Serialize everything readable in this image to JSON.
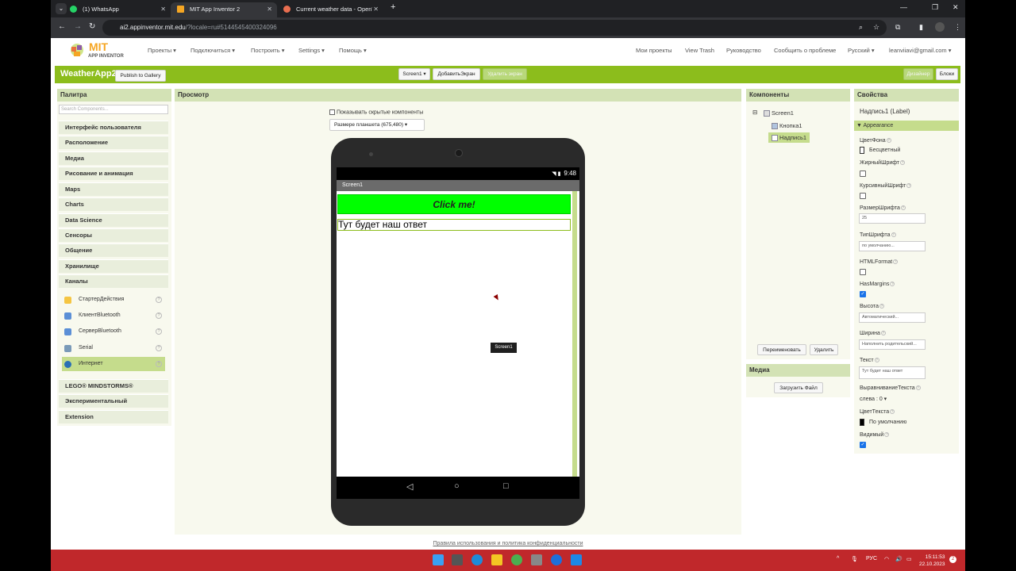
{
  "browser": {
    "tabs": [
      {
        "title": "(1) WhatsApp"
      },
      {
        "title": "MIT App Inventor 2"
      },
      {
        "title": "Current weather data - OpenW"
      }
    ],
    "url_main": "ai2.appinventor.mit.edu",
    "url_rest": "/?locale=ru#5144545400324096"
  },
  "app": {
    "logo_main": "MIT",
    "logo_sub": "APP INVENTOR",
    "menu": [
      "Проекты ▾",
      "Подключиться ▾",
      "Построить ▾",
      "Settings ▾",
      "Помощь ▾"
    ],
    "right_menu": [
      "Мои проекты",
      "View Trash",
      "Руководство",
      "Сообщить о проблеме",
      "Русский ▾",
      "leanviiavi@gmail.com ▾"
    ]
  },
  "toolbar": {
    "project_name": "WeatherApp2",
    "publish": "Publish to Gallery",
    "screen_select": "Screen1 ▾",
    "add_screen": "ДобавитьЭкран",
    "remove_screen": "Удалить экран",
    "designer": "Дизайнер",
    "blocks": "Блоки"
  },
  "palette": {
    "title": "Палитра",
    "search_placeholder": "Search Components...",
    "categories_top": [
      "Интерфейс пользователя",
      "Расположение",
      "Медиа",
      "Рисование и анимация",
      "Maps",
      "Charts",
      "Data Science",
      "Сенсоры",
      "Общение",
      "Хранилище",
      "Каналы"
    ],
    "items": [
      "СтартерДействия",
      "КлиентBluetooth",
      "СерверBluetooth",
      "Serial",
      "Интернет"
    ],
    "categories_bottom": [
      "LEGO® MINDSTORMS®",
      "Экспериментальный",
      "Extension"
    ]
  },
  "viewer": {
    "title": "Просмотр",
    "show_hidden": "Показывать скрытые компоненты",
    "size_select": "Размере планшета (675,480) ▾",
    "time": "9:48",
    "screen_title": "Screen1",
    "button_text": "Click me!",
    "label_text": "Тут будет наш ответ",
    "tooltip": "Screen1"
  },
  "components": {
    "title": "Компоненты",
    "tree": [
      "Screen1",
      "Кнопка1",
      "Надпись1"
    ],
    "rename": "Переименовать",
    "delete": "Удалить",
    "media_title": "Медиа",
    "upload": "Загрузить Файл"
  },
  "properties": {
    "title": "Свойства",
    "component": "Надпись1 (Label)",
    "section": "Appearance",
    "bg_color_label": "ЦветФона",
    "bg_color_value": "Бесцветный",
    "bold_label": "ЖирныйШрифт",
    "italic_label": "КурсивныйШрифт",
    "font_size_label": "РазмерШрифта",
    "font_size_value": "25",
    "font_type_label": "ТипШрифта",
    "font_type_value": "по умолчанию...",
    "html_label": "HTMLFormat",
    "margins_label": "HasMargins",
    "height_label": "Высота",
    "height_value": "Автоматический...",
    "width_label": "Ширина",
    "width_value": "Наполнить родительский...",
    "text_label": "Текст",
    "text_value": "Тут будет наш ответ",
    "align_label": "ВыравниваниеТекста",
    "align_value": "слева : 0 ▾",
    "text_color_label": "ЦветТекста",
    "text_color_value": "По умолчанию",
    "visible_label": "Видимый"
  },
  "footer": "Правила использования и политика конфиденциальности",
  "taskbar": {
    "lang": "РУС",
    "time": "15:11:53",
    "date": "22.10.2023"
  },
  "colors": {
    "accent": "#8cbd1c",
    "button_green": "#00ff00",
    "taskbar": "#c0282b"
  }
}
